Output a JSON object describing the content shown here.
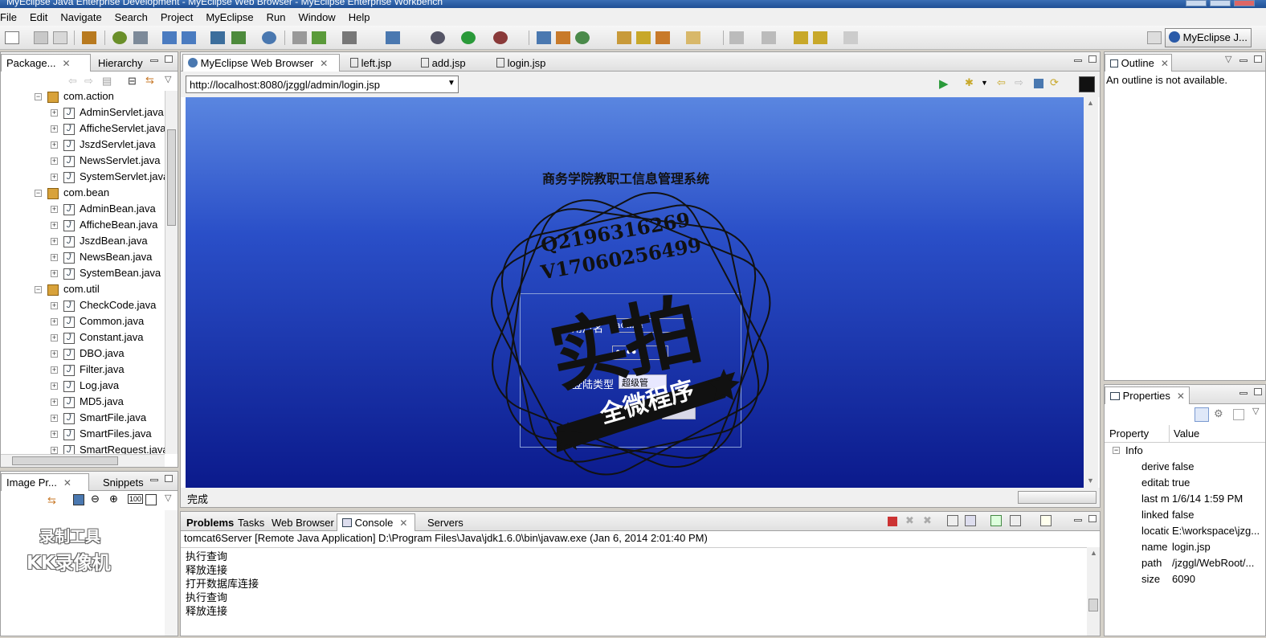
{
  "window": {
    "title": "MyEclipse Java Enterprise Development - MyEclipse Web Browser - MyEclipse Enterprise Workbench"
  },
  "menu": [
    "File",
    "Edit",
    "Navigate",
    "Search",
    "Project",
    "MyEclipse",
    "Run",
    "Window",
    "Help"
  ],
  "perspective": {
    "label": "MyEclipse J..."
  },
  "package_explorer": {
    "tabs": [
      "Package...",
      "Hierarchy"
    ],
    "tree": [
      {
        "label": "com.action",
        "kind": "pkg",
        "level": 0
      },
      {
        "label": "AdminServlet.java",
        "kind": "java",
        "level": 1
      },
      {
        "label": "AfficheServlet.java",
        "kind": "java",
        "level": 1
      },
      {
        "label": "JszdServlet.java",
        "kind": "java",
        "level": 1
      },
      {
        "label": "NewsServlet.java",
        "kind": "java",
        "level": 1
      },
      {
        "label": "SystemServlet.java",
        "kind": "java",
        "level": 1
      },
      {
        "label": "com.bean",
        "kind": "pkg",
        "level": 0
      },
      {
        "label": "AdminBean.java",
        "kind": "java",
        "level": 1
      },
      {
        "label": "AfficheBean.java",
        "kind": "java",
        "level": 1
      },
      {
        "label": "JszdBean.java",
        "kind": "java",
        "level": 1
      },
      {
        "label": "NewsBean.java",
        "kind": "java",
        "level": 1
      },
      {
        "label": "SystemBean.java",
        "kind": "java",
        "level": 1
      },
      {
        "label": "com.util",
        "kind": "pkg",
        "level": 0
      },
      {
        "label": "CheckCode.java",
        "kind": "java",
        "level": 1
      },
      {
        "label": "Common.java",
        "kind": "java",
        "level": 1
      },
      {
        "label": "Constant.java",
        "kind": "java",
        "level": 1
      },
      {
        "label": "DBO.java",
        "kind": "java",
        "level": 1
      },
      {
        "label": "Filter.java",
        "kind": "java",
        "level": 1
      },
      {
        "label": "Log.java",
        "kind": "java",
        "level": 1
      },
      {
        "label": "MD5.java",
        "kind": "java",
        "level": 1
      },
      {
        "label": "SmartFile.java",
        "kind": "java",
        "level": 1
      },
      {
        "label": "SmartFiles.java",
        "kind": "java",
        "level": 1
      },
      {
        "label": "SmartRequest.java",
        "kind": "java",
        "level": 1
      }
    ]
  },
  "image_panel": {
    "tabs": [
      "Image Pr...",
      "Snippets"
    ]
  },
  "editor": {
    "tabs": [
      "MyEclipse Web Browser",
      "left.jsp",
      "add.jsp",
      "login.jsp"
    ],
    "url": "http://localhost:8080/jzggl/admin/login.jsp",
    "status": "完成"
  },
  "login_page": {
    "title": "商务学院教职工信息管理系统",
    "username_label": "用户名",
    "username_value": "admin",
    "password_mask": "●●●●",
    "role_label": "登陆类型",
    "role_value": "超级管"
  },
  "watermark": {
    "qq": "Q2196316269",
    "wx": "V17060256499",
    "big": "实拍",
    "banner": "全微程序",
    "recorder_line1": "录制工具",
    "recorder_line2": "KK录像机"
  },
  "outline": {
    "tab": "Outline",
    "message": "An outline is not available."
  },
  "console": {
    "tabs": [
      "Problems",
      "Tasks",
      "Web Browser",
      "Console",
      "Servers"
    ],
    "header": "tomcat6Server [Remote Java Application] D:\\Program Files\\Java\\jdk1.6.0\\bin\\javaw.exe (Jan 6, 2014 2:01:40 PM)",
    "lines": [
      "执行查询",
      "释放连接",
      "打开数据库连接",
      "执行查询",
      "释放连接"
    ]
  },
  "properties": {
    "tab": "Properties",
    "headers": [
      "Property",
      "Value"
    ],
    "category": "Info",
    "rows": [
      {
        "k": "derive",
        "v": "false"
      },
      {
        "k": "editab",
        "v": "true"
      },
      {
        "k": "last m",
        "v": "1/6/14 1:59 PM"
      },
      {
        "k": "linked",
        "v": "false"
      },
      {
        "k": "locatic",
        "v": "E:\\workspace\\jzg..."
      },
      {
        "k": "name",
        "v": "login.jsp"
      },
      {
        "k": "path",
        "v": "/jzggl/WebRoot/..."
      },
      {
        "k": "size",
        "v": "6090"
      }
    ]
  },
  "colors": {
    "accent": "#3a6fb5",
    "browser_top": "#5a86e0",
    "browser_bottom": "#0b1a8c"
  }
}
